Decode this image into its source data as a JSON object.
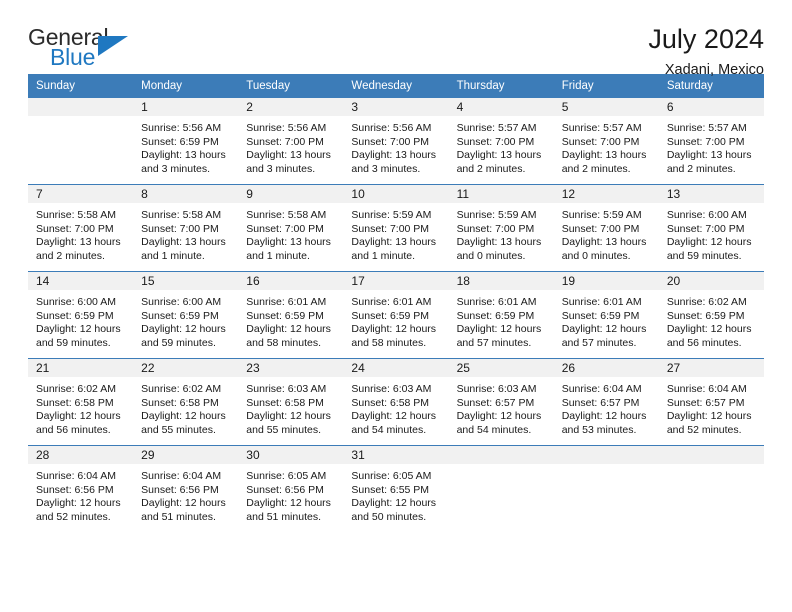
{
  "brand": {
    "name_part1": "General",
    "name_part2": "Blue",
    "accent_color": "#1f78c1"
  },
  "header": {
    "title": "July 2024",
    "location": "Xadani, Mexico"
  },
  "calendar": {
    "header_bg": "#3c7cb8",
    "daynum_bg": "#f1f1f1",
    "weekdays": [
      "Sunday",
      "Monday",
      "Tuesday",
      "Wednesday",
      "Thursday",
      "Friday",
      "Saturday"
    ],
    "weeks": [
      [
        {
          "day": "",
          "sunrise": "",
          "sunset": "",
          "daylight_line1": "",
          "daylight_line2": ""
        },
        {
          "day": "1",
          "sunrise": "Sunrise: 5:56 AM",
          "sunset": "Sunset: 6:59 PM",
          "daylight_line1": "Daylight: 13 hours",
          "daylight_line2": "and 3 minutes."
        },
        {
          "day": "2",
          "sunrise": "Sunrise: 5:56 AM",
          "sunset": "Sunset: 7:00 PM",
          "daylight_line1": "Daylight: 13 hours",
          "daylight_line2": "and 3 minutes."
        },
        {
          "day": "3",
          "sunrise": "Sunrise: 5:56 AM",
          "sunset": "Sunset: 7:00 PM",
          "daylight_line1": "Daylight: 13 hours",
          "daylight_line2": "and 3 minutes."
        },
        {
          "day": "4",
          "sunrise": "Sunrise: 5:57 AM",
          "sunset": "Sunset: 7:00 PM",
          "daylight_line1": "Daylight: 13 hours",
          "daylight_line2": "and 2 minutes."
        },
        {
          "day": "5",
          "sunrise": "Sunrise: 5:57 AM",
          "sunset": "Sunset: 7:00 PM",
          "daylight_line1": "Daylight: 13 hours",
          "daylight_line2": "and 2 minutes."
        },
        {
          "day": "6",
          "sunrise": "Sunrise: 5:57 AM",
          "sunset": "Sunset: 7:00 PM",
          "daylight_line1": "Daylight: 13 hours",
          "daylight_line2": "and 2 minutes."
        }
      ],
      [
        {
          "day": "7",
          "sunrise": "Sunrise: 5:58 AM",
          "sunset": "Sunset: 7:00 PM",
          "daylight_line1": "Daylight: 13 hours",
          "daylight_line2": "and 2 minutes."
        },
        {
          "day": "8",
          "sunrise": "Sunrise: 5:58 AM",
          "sunset": "Sunset: 7:00 PM",
          "daylight_line1": "Daylight: 13 hours",
          "daylight_line2": "and 1 minute."
        },
        {
          "day": "9",
          "sunrise": "Sunrise: 5:58 AM",
          "sunset": "Sunset: 7:00 PM",
          "daylight_line1": "Daylight: 13 hours",
          "daylight_line2": "and 1 minute."
        },
        {
          "day": "10",
          "sunrise": "Sunrise: 5:59 AM",
          "sunset": "Sunset: 7:00 PM",
          "daylight_line1": "Daylight: 13 hours",
          "daylight_line2": "and 1 minute."
        },
        {
          "day": "11",
          "sunrise": "Sunrise: 5:59 AM",
          "sunset": "Sunset: 7:00 PM",
          "daylight_line1": "Daylight: 13 hours",
          "daylight_line2": "and 0 minutes."
        },
        {
          "day": "12",
          "sunrise": "Sunrise: 5:59 AM",
          "sunset": "Sunset: 7:00 PM",
          "daylight_line1": "Daylight: 13 hours",
          "daylight_line2": "and 0 minutes."
        },
        {
          "day": "13",
          "sunrise": "Sunrise: 6:00 AM",
          "sunset": "Sunset: 7:00 PM",
          "daylight_line1": "Daylight: 12 hours",
          "daylight_line2": "and 59 minutes."
        }
      ],
      [
        {
          "day": "14",
          "sunrise": "Sunrise: 6:00 AM",
          "sunset": "Sunset: 6:59 PM",
          "daylight_line1": "Daylight: 12 hours",
          "daylight_line2": "and 59 minutes."
        },
        {
          "day": "15",
          "sunrise": "Sunrise: 6:00 AM",
          "sunset": "Sunset: 6:59 PM",
          "daylight_line1": "Daylight: 12 hours",
          "daylight_line2": "and 59 minutes."
        },
        {
          "day": "16",
          "sunrise": "Sunrise: 6:01 AM",
          "sunset": "Sunset: 6:59 PM",
          "daylight_line1": "Daylight: 12 hours",
          "daylight_line2": "and 58 minutes."
        },
        {
          "day": "17",
          "sunrise": "Sunrise: 6:01 AM",
          "sunset": "Sunset: 6:59 PM",
          "daylight_line1": "Daylight: 12 hours",
          "daylight_line2": "and 58 minutes."
        },
        {
          "day": "18",
          "sunrise": "Sunrise: 6:01 AM",
          "sunset": "Sunset: 6:59 PM",
          "daylight_line1": "Daylight: 12 hours",
          "daylight_line2": "and 57 minutes."
        },
        {
          "day": "19",
          "sunrise": "Sunrise: 6:01 AM",
          "sunset": "Sunset: 6:59 PM",
          "daylight_line1": "Daylight: 12 hours",
          "daylight_line2": "and 57 minutes."
        },
        {
          "day": "20",
          "sunrise": "Sunrise: 6:02 AM",
          "sunset": "Sunset: 6:59 PM",
          "daylight_line1": "Daylight: 12 hours",
          "daylight_line2": "and 56 minutes."
        }
      ],
      [
        {
          "day": "21",
          "sunrise": "Sunrise: 6:02 AM",
          "sunset": "Sunset: 6:58 PM",
          "daylight_line1": "Daylight: 12 hours",
          "daylight_line2": "and 56 minutes."
        },
        {
          "day": "22",
          "sunrise": "Sunrise: 6:02 AM",
          "sunset": "Sunset: 6:58 PM",
          "daylight_line1": "Daylight: 12 hours",
          "daylight_line2": "and 55 minutes."
        },
        {
          "day": "23",
          "sunrise": "Sunrise: 6:03 AM",
          "sunset": "Sunset: 6:58 PM",
          "daylight_line1": "Daylight: 12 hours",
          "daylight_line2": "and 55 minutes."
        },
        {
          "day": "24",
          "sunrise": "Sunrise: 6:03 AM",
          "sunset": "Sunset: 6:58 PM",
          "daylight_line1": "Daylight: 12 hours",
          "daylight_line2": "and 54 minutes."
        },
        {
          "day": "25",
          "sunrise": "Sunrise: 6:03 AM",
          "sunset": "Sunset: 6:57 PM",
          "daylight_line1": "Daylight: 12 hours",
          "daylight_line2": "and 54 minutes."
        },
        {
          "day": "26",
          "sunrise": "Sunrise: 6:04 AM",
          "sunset": "Sunset: 6:57 PM",
          "daylight_line1": "Daylight: 12 hours",
          "daylight_line2": "and 53 minutes."
        },
        {
          "day": "27",
          "sunrise": "Sunrise: 6:04 AM",
          "sunset": "Sunset: 6:57 PM",
          "daylight_line1": "Daylight: 12 hours",
          "daylight_line2": "and 52 minutes."
        }
      ],
      [
        {
          "day": "28",
          "sunrise": "Sunrise: 6:04 AM",
          "sunset": "Sunset: 6:56 PM",
          "daylight_line1": "Daylight: 12 hours",
          "daylight_line2": "and 52 minutes."
        },
        {
          "day": "29",
          "sunrise": "Sunrise: 6:04 AM",
          "sunset": "Sunset: 6:56 PM",
          "daylight_line1": "Daylight: 12 hours",
          "daylight_line2": "and 51 minutes."
        },
        {
          "day": "30",
          "sunrise": "Sunrise: 6:05 AM",
          "sunset": "Sunset: 6:56 PM",
          "daylight_line1": "Daylight: 12 hours",
          "daylight_line2": "and 51 minutes."
        },
        {
          "day": "31",
          "sunrise": "Sunrise: 6:05 AM",
          "sunset": "Sunset: 6:55 PM",
          "daylight_line1": "Daylight: 12 hours",
          "daylight_line2": "and 50 minutes."
        },
        {
          "day": "",
          "sunrise": "",
          "sunset": "",
          "daylight_line1": "",
          "daylight_line2": ""
        },
        {
          "day": "",
          "sunrise": "",
          "sunset": "",
          "daylight_line1": "",
          "daylight_line2": ""
        },
        {
          "day": "",
          "sunrise": "",
          "sunset": "",
          "daylight_line1": "",
          "daylight_line2": ""
        }
      ]
    ]
  }
}
